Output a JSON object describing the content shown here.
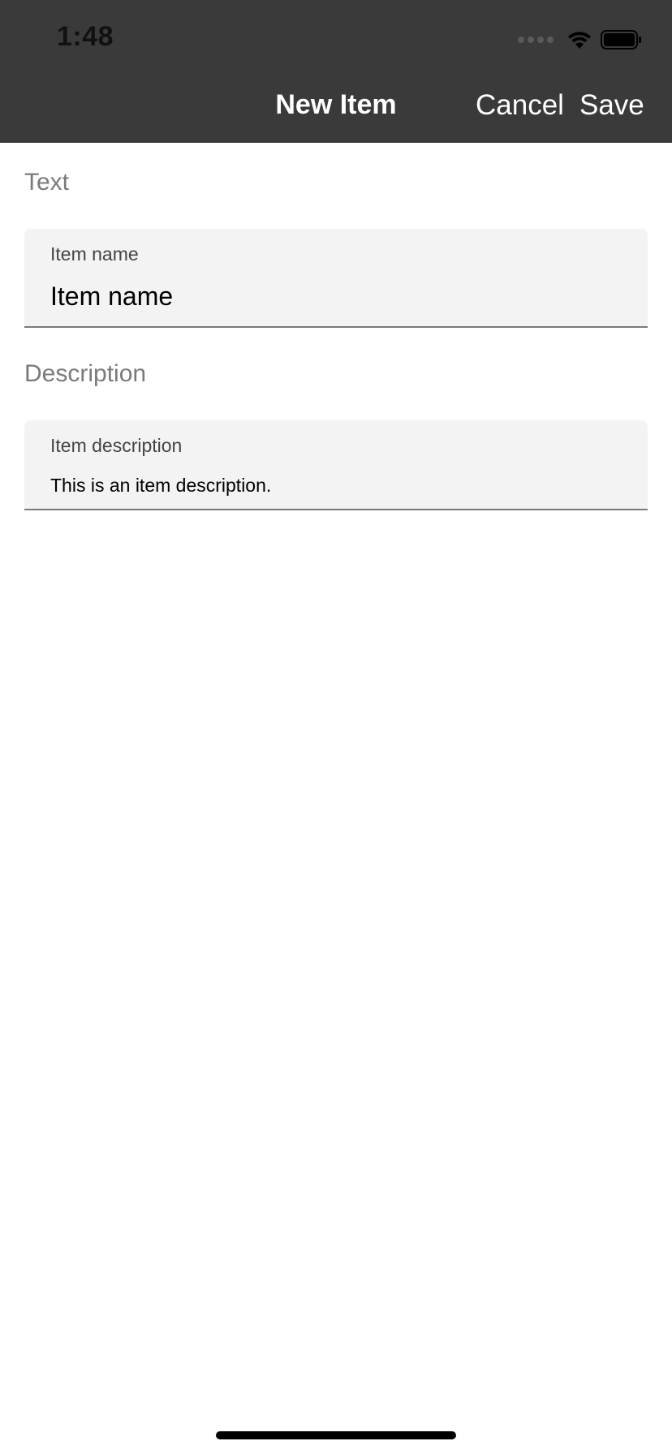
{
  "status_bar": {
    "time": "1:48"
  },
  "nav": {
    "title": "New Item",
    "cancel_label": "Cancel",
    "save_label": "Save"
  },
  "form": {
    "text_section_label": "Text",
    "name_field": {
      "label": "Item name",
      "value": "Item name"
    },
    "description_section_label": "Description",
    "description_field": {
      "label": "Item description",
      "value": "This is an item description."
    }
  },
  "icons": {
    "signal": "cellular-signal-icon",
    "wifi": "wifi-icon",
    "battery": "battery-icon"
  },
  "colors": {
    "header_bg": "#3a3a3a",
    "field_bg": "#f3f3f3",
    "section_label": "#7a7a7a"
  }
}
